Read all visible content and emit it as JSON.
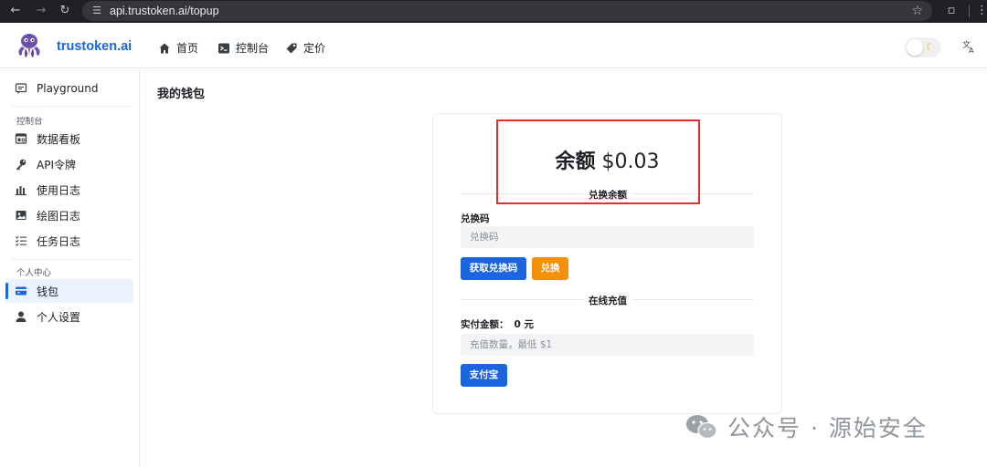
{
  "browser": {
    "url": "api.trustoken.ai/topup"
  },
  "header": {
    "brand": "trustoken.ai",
    "nav": [
      {
        "label": "首页",
        "icon": "home-icon"
      },
      {
        "label": "控制台",
        "icon": "terminal-icon"
      },
      {
        "label": "定价",
        "icon": "tag-icon"
      }
    ],
    "theme_toggle": {
      "state": "light",
      "icon": "moon-icon"
    },
    "language_icon": "translate-icon"
  },
  "sidebar": {
    "top_item": {
      "label": "Playground",
      "icon": "chat-icon"
    },
    "console_section": "控制台",
    "console_items": [
      {
        "label": "数据看板",
        "icon": "dashboard-icon"
      },
      {
        "label": "API令牌",
        "icon": "key-icon"
      },
      {
        "label": "使用日志",
        "icon": "bar-chart-icon"
      },
      {
        "label": "绘图日志",
        "icon": "image-icon"
      },
      {
        "label": "任务日志",
        "icon": "task-list-icon"
      }
    ],
    "personal_section": "个人中心",
    "personal_items": [
      {
        "label": "钱包",
        "icon": "wallet-icon",
        "active": true
      },
      {
        "label": "个人设置",
        "icon": "user-icon"
      }
    ]
  },
  "main": {
    "page_title": "我的钱包",
    "balance": {
      "label": "余额",
      "amount": "$0.03"
    },
    "redeem": {
      "section_title": "兑换余额",
      "code_label": "兑换码",
      "code_placeholder": "兑换码",
      "get_code_button": "获取兑换码",
      "redeem_button": "兑换"
    },
    "online": {
      "section_title": "在线充值",
      "amount_label": "实付金额：",
      "amount_value": "0 元",
      "quantity_placeholder": "充值数量，最低 $1",
      "alipay_button": "支付宝"
    }
  },
  "watermark": {
    "text": "公众号 · 源始安全"
  },
  "colors": {
    "brand_blue": "#1b66e0",
    "orange": "#f79009",
    "highlight_red": "#e4302b"
  }
}
